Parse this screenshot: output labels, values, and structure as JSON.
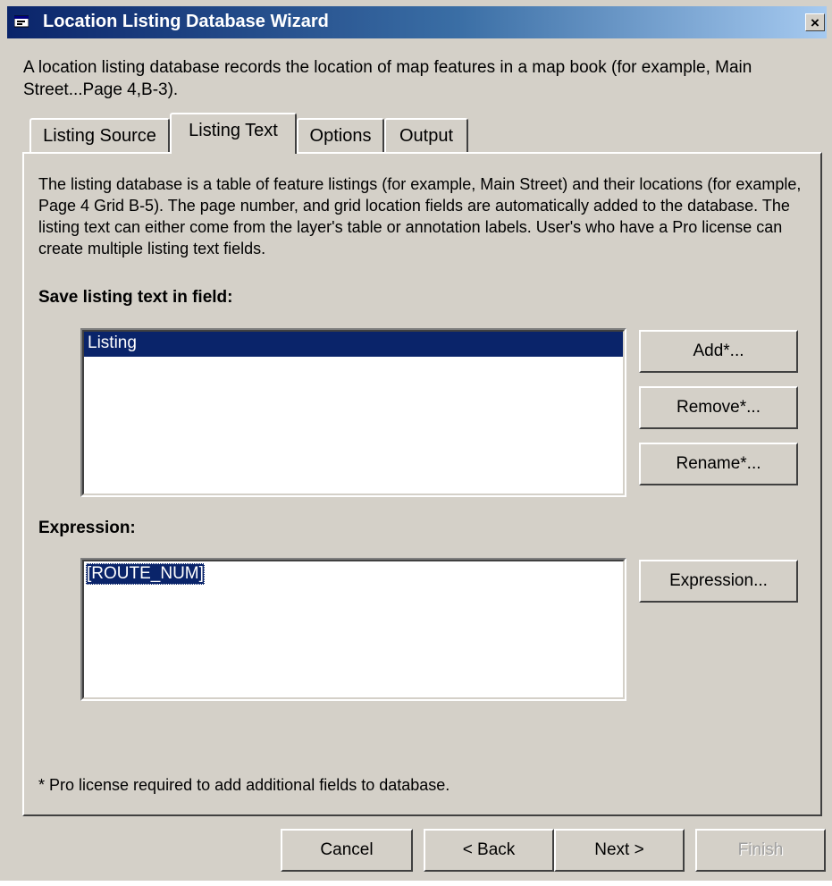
{
  "window": {
    "title": "Location Listing Database Wizard",
    "close_label": "×",
    "intro_text": "A location listing database records the location of map features in a map book (for example, Main Street...Page 4,B-3)."
  },
  "tabs": [
    {
      "label": "Listing Source",
      "active": false
    },
    {
      "label": "Listing Text",
      "active": true
    },
    {
      "label": "Options",
      "active": false
    },
    {
      "label": "Output",
      "active": false
    }
  ],
  "panel": {
    "description": "The listing database is a table of feature listings (for example, Main Street) and their locations (for example, Page 4 Grid B-5).  The page number, and grid location fields are automatically added to the database.  The listing text can either come from the layer's table or annotation labels.  User's who have a Pro license can create multiple listing text fields.",
    "save_label": "Save listing text in field:",
    "fields": [
      "Listing"
    ],
    "selected_field": "Listing",
    "buttons": {
      "add": "Add*...",
      "remove": "Remove*...",
      "rename": "Rename*..."
    },
    "expression_label": "Expression:",
    "expression_value": "[ROUTE_NUM]",
    "expression_button": "Expression...",
    "footnote": "* Pro license required to add additional fields to database."
  },
  "footer": {
    "cancel": "Cancel",
    "back": "< Back",
    "next": "Next >",
    "finish": "Finish",
    "finish_enabled": false
  },
  "colors": {
    "face": "#d4d0c8",
    "selection": "#0a246a",
    "title_start": "#0a246a",
    "title_end": "#a6caf0"
  }
}
